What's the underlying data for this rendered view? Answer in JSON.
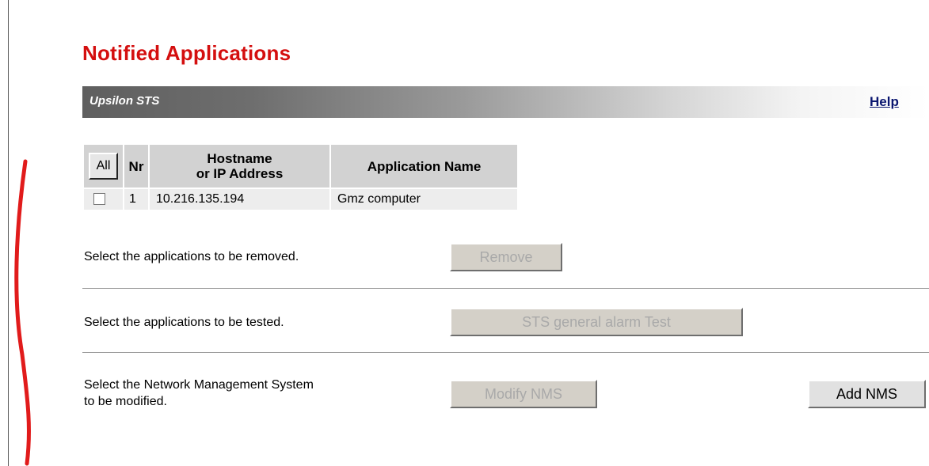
{
  "page": {
    "title": "Notified Applications"
  },
  "header_bar": {
    "label": "Upsilon STS",
    "help_link": "Help"
  },
  "table": {
    "columns": [
      "All",
      "Nr",
      "Hostname or IP Address",
      "Application Name"
    ],
    "all_button": "All",
    "col_nr": "Nr",
    "col_host_line1": "Hostname",
    "col_host_line2": "or IP Address",
    "col_app": "Application Name",
    "rows": [
      {
        "checked": false,
        "nr": "1",
        "host": "10.216.135.194",
        "app": "Gmz computer"
      }
    ]
  },
  "actions": {
    "remove_text": "Select the applications to be removed.",
    "remove_button": "Remove",
    "test_text": "Select the applications to be tested.",
    "test_button": "STS general alarm Test",
    "nms_text_line1": "Select the Network Management System",
    "nms_text_line2": "to be modified.",
    "modify_button": "Modify NMS",
    "add_button": "Add NMS"
  },
  "colors": {
    "title": "#d40f0f",
    "help_link": "#0a1670",
    "header_cell": "#d2d2d2",
    "row_cell": "#ededed"
  }
}
